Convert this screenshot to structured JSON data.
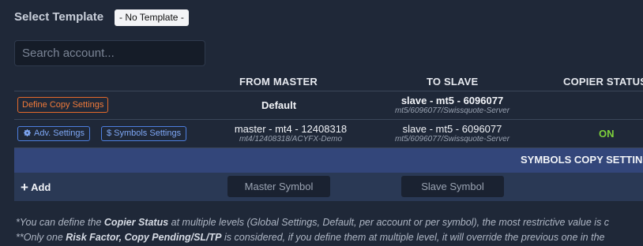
{
  "header": {
    "title": "Select Template",
    "template_value": "- No Template -"
  },
  "search": {
    "placeholder": "Search account..."
  },
  "table": {
    "columns": [
      "FROM MASTER",
      "TO SLAVE",
      "COPIER STATUS"
    ],
    "default_row": {
      "button_label": "Define Copy Settings",
      "from_master": "Default",
      "to_slave_main": "slave - mt5 - 6096077",
      "to_slave_sub": "mt5/6096077/Swissquote-Server"
    },
    "account_row": {
      "adv_settings_label": "Adv. Settings",
      "symbols_settings_label": "Symbols Settings",
      "from_master_main": "master - mt4 - 12408318",
      "from_master_sub": "mt4/12408318/ACYFX-Demo",
      "to_slave_main": "slave - mt5 - 6096077",
      "to_slave_sub": "mt5/6096077/Swissquote-Server",
      "status": "ON"
    }
  },
  "symbols_panel": {
    "title": "SYMBOLS COPY SETTINGS",
    "add_label": "Add",
    "master_placeholder": "Master Symbol",
    "slave_placeholder": "Slave Symbol"
  },
  "footnotes": {
    "line1": {
      "prefix": "*",
      "t1": "You can define the ",
      "b1": "Copier Status",
      "t2": " at multiple levels (Global Settings, Default, per account or per symbol), the most restrictive value is c"
    },
    "line2": {
      "prefix": "**",
      "t1": "Only one ",
      "b1": "Risk Factor, Copy Pending/SL/TP",
      "t2": " is considered, if you define them at multiple level, it will override the previous one in the"
    }
  },
  "colors": {
    "background": "#1f2838",
    "accent_orange": "#f07a3a",
    "accent_blue": "#7ea7f5",
    "status_on": "#7dd13b",
    "panel_blue": "#33467a"
  }
}
